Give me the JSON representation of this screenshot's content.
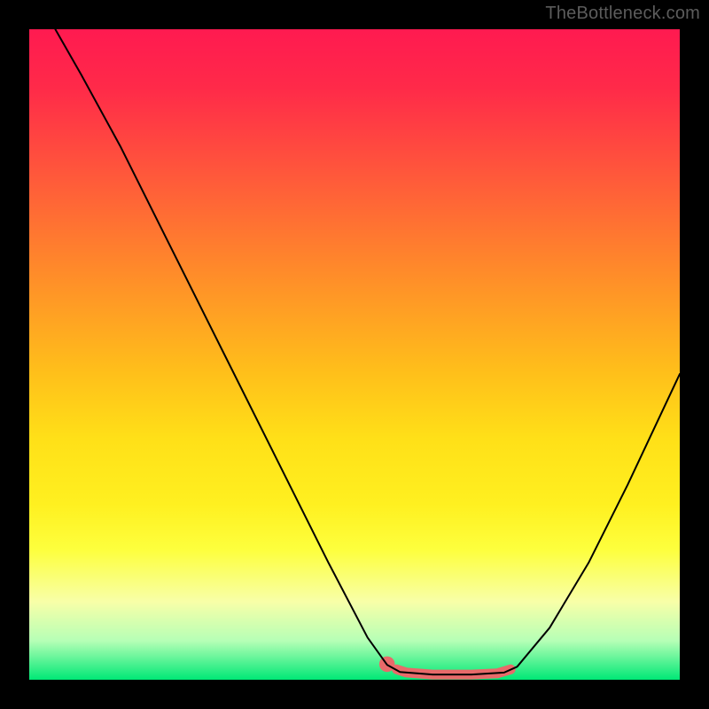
{
  "watermark": "TheBottleneck.com",
  "chart_data": {
    "type": "line",
    "title": "",
    "xlabel": "",
    "ylabel": "",
    "xlim": [
      0,
      100
    ],
    "ylim": [
      0,
      100
    ],
    "background_gradient_stops": [
      {
        "pos": 0.0,
        "color": "#ff1a50"
      },
      {
        "pos": 0.09,
        "color": "#ff2a49"
      },
      {
        "pos": 0.23,
        "color": "#ff5a3a"
      },
      {
        "pos": 0.37,
        "color": "#ff8a2a"
      },
      {
        "pos": 0.53,
        "color": "#ffc01a"
      },
      {
        "pos": 0.63,
        "color": "#ffe018"
      },
      {
        "pos": 0.73,
        "color": "#fff020"
      },
      {
        "pos": 0.8,
        "color": "#fdff3d"
      },
      {
        "pos": 0.88,
        "color": "#f8ffa8"
      },
      {
        "pos": 0.94,
        "color": "#b6ffb6"
      },
      {
        "pos": 1.0,
        "color": "#00e876"
      }
    ],
    "series": [
      {
        "name": "bottleneck-curve",
        "color": "#000000",
        "stroke_width": 2,
        "points": [
          {
            "x": 4.0,
            "y": 100.0
          },
          {
            "x": 8.0,
            "y": 93.0
          },
          {
            "x": 14.0,
            "y": 82.0
          },
          {
            "x": 22.0,
            "y": 66.0
          },
          {
            "x": 30.0,
            "y": 50.0
          },
          {
            "x": 38.0,
            "y": 34.0
          },
          {
            "x": 46.0,
            "y": 18.0
          },
          {
            "x": 52.0,
            "y": 6.5
          },
          {
            "x": 55.0,
            "y": 2.3
          },
          {
            "x": 57.0,
            "y": 1.2
          },
          {
            "x": 62.0,
            "y": 0.8
          },
          {
            "x": 68.0,
            "y": 0.8
          },
          {
            "x": 73.0,
            "y": 1.1
          },
          {
            "x": 75.0,
            "y": 2.0
          },
          {
            "x": 80.0,
            "y": 8.0
          },
          {
            "x": 86.0,
            "y": 18.0
          },
          {
            "x": 92.0,
            "y": 30.0
          },
          {
            "x": 100.0,
            "y": 47.0
          }
        ]
      },
      {
        "name": "optimal-zone-marker",
        "color": "#e86a6a",
        "stroke_width": 11,
        "points": [
          {
            "x": 56.5,
            "y": 1.6
          },
          {
            "x": 58.0,
            "y": 1.1
          },
          {
            "x": 62.0,
            "y": 0.8
          },
          {
            "x": 68.0,
            "y": 0.8
          },
          {
            "x": 72.0,
            "y": 1.0
          },
          {
            "x": 74.0,
            "y": 1.6
          }
        ]
      }
    ],
    "markers": [
      {
        "name": "optimal-start-dot",
        "x": 55.0,
        "y": 2.4,
        "r": 1.2,
        "color": "#e86a6a"
      }
    ]
  }
}
